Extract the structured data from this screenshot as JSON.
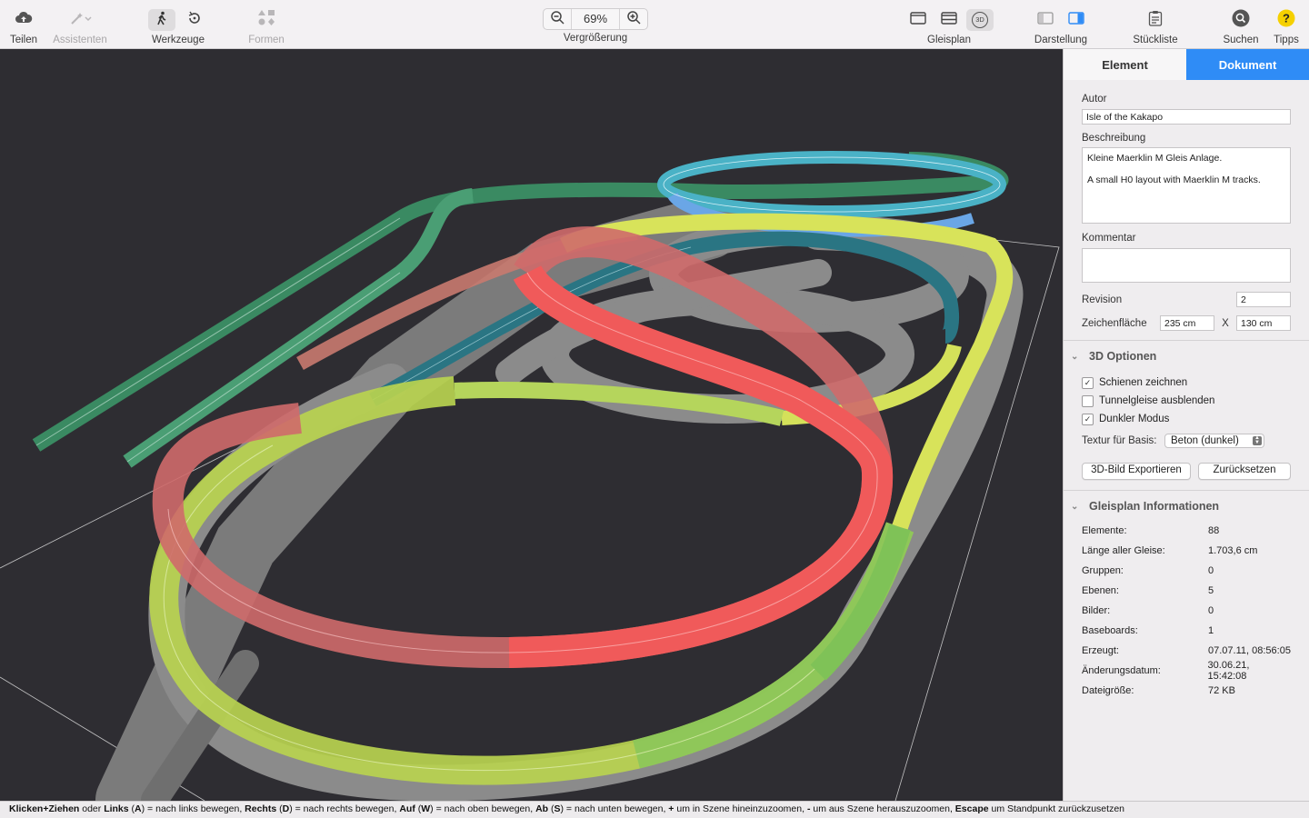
{
  "toolbar": {
    "share_label": "Teilen",
    "assistants_label": "Assistenten",
    "tools_label": "Werkzeuge",
    "shapes_label": "Formen",
    "zoom_value": "69%",
    "zoom_label": "Vergrößerung",
    "trackplan_label": "Gleisplan",
    "view_label": "Darstellung",
    "partslist_label": "Stückliste",
    "search_label": "Suchen",
    "tips_label": "Tipps",
    "threed_badge": "3D"
  },
  "inspector": {
    "tabs": [
      {
        "label": "Element",
        "active": false
      },
      {
        "label": "Dokument",
        "active": true
      }
    ],
    "author_label": "Autor",
    "author_value": "Isle of the Kakapo",
    "description_label": "Beschreibung",
    "description_line1": "Kleine Maerklin M Gleis Anlage.",
    "description_line2": "A small H0 layout with Maerklin M tracks.",
    "comment_label": "Kommentar",
    "comment_value": "",
    "revision_label": "Revision",
    "revision_value": "2",
    "canvas_label": "Zeichenfläche",
    "canvas_width": "235 cm",
    "canvas_x": "X",
    "canvas_height": "130 cm",
    "options3d": {
      "title": "3D Optionen",
      "draw_rails": {
        "label": "Schienen zeichnen",
        "checked": true
      },
      "hide_tunnels": {
        "label": "Tunnelgleise ausblenden",
        "checked": false
      },
      "dark_mode": {
        "label": "Dunkler Modus",
        "checked": true
      },
      "texture_label": "Textur für Basis:",
      "texture_value": "Beton (dunkel)",
      "export_button": "3D-Bild Exportieren",
      "reset_button": "Zurücksetzen"
    },
    "info": {
      "title": "Gleisplan Informationen",
      "rows": [
        {
          "key": "Elemente:",
          "value": "88"
        },
        {
          "key": "Länge aller Gleise:",
          "value": "1.703,6 cm"
        },
        {
          "key": "Gruppen:",
          "value": "0"
        },
        {
          "key": "Ebenen:",
          "value": "5"
        },
        {
          "key": "Bilder:",
          "value": "0"
        },
        {
          "key": "Baseboards:",
          "value": "1"
        },
        {
          "key": "Erzeugt:",
          "value": "07.07.11, 08:56:05"
        },
        {
          "key": "Änderungsdatum:",
          "value": "30.06.21, 15:42:08"
        },
        {
          "key": "Dateigröße:",
          "value": "72 KB"
        }
      ]
    }
  },
  "status": {
    "p1": "Klicken+Ziehen",
    "t1": " oder ",
    "p2": "Links",
    "t2": " (",
    "p3": "A",
    "t3": ") = nach links bewegen, ",
    "p4": "Rechts",
    "t4": " (",
    "p5": "D",
    "t5": ") = nach rechts bewegen, ",
    "p6": "Auf",
    "t6": " (",
    "p7": "W",
    "t7": ") = nach oben bewegen, ",
    "p8": "Ab",
    "t8": " (",
    "p9": "S",
    "t9": ") = nach unten bewegen, ",
    "p10": "+",
    "t10": " um in Szene hineinzuzoomen, ",
    "p11": "-",
    "t11": " um aus Szene herauszuzoomen, ",
    "p12": "Escape",
    "t12": " um Standpunkt zurückzusetzen"
  },
  "colors": {
    "accent": "#2f8cf6",
    "track_red": "#ee5a5a",
    "track_yellow": "#d7e357",
    "track_green": "#88c65a",
    "track_teal": "#2f7f8c",
    "track_cyan": "#4fb3c9",
    "track_darkgreen": "#3f9a6c",
    "baseboard": "#8d8d8d"
  }
}
